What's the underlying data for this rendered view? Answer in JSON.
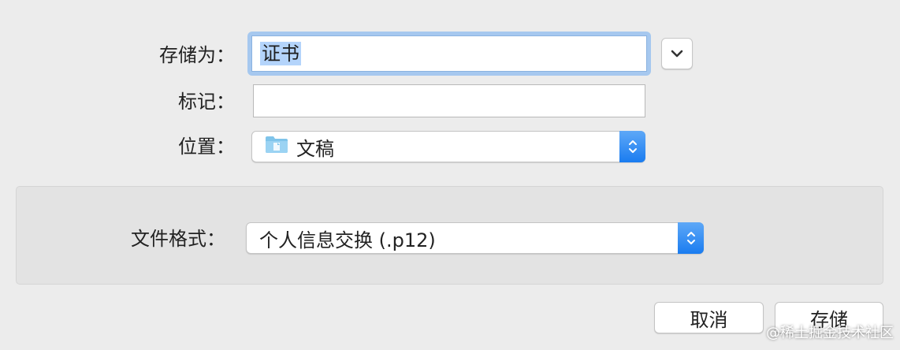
{
  "save_as": {
    "label": "存储为：",
    "value": "证书"
  },
  "tags": {
    "label": "标记：",
    "value": ""
  },
  "location": {
    "label": "位置：",
    "value": "文稿",
    "folder_icon": "folder-icon"
  },
  "format": {
    "label": "文件格式：",
    "value": "个人信息交换 (.p12)"
  },
  "buttons": {
    "cancel": "取消",
    "save": "存储"
  },
  "watermark": "@稀土掘金技术社区",
  "colors": {
    "accent": "#1a7cf0",
    "focus_ring": "#a6c8ef",
    "selection": "#b4d4fb"
  }
}
